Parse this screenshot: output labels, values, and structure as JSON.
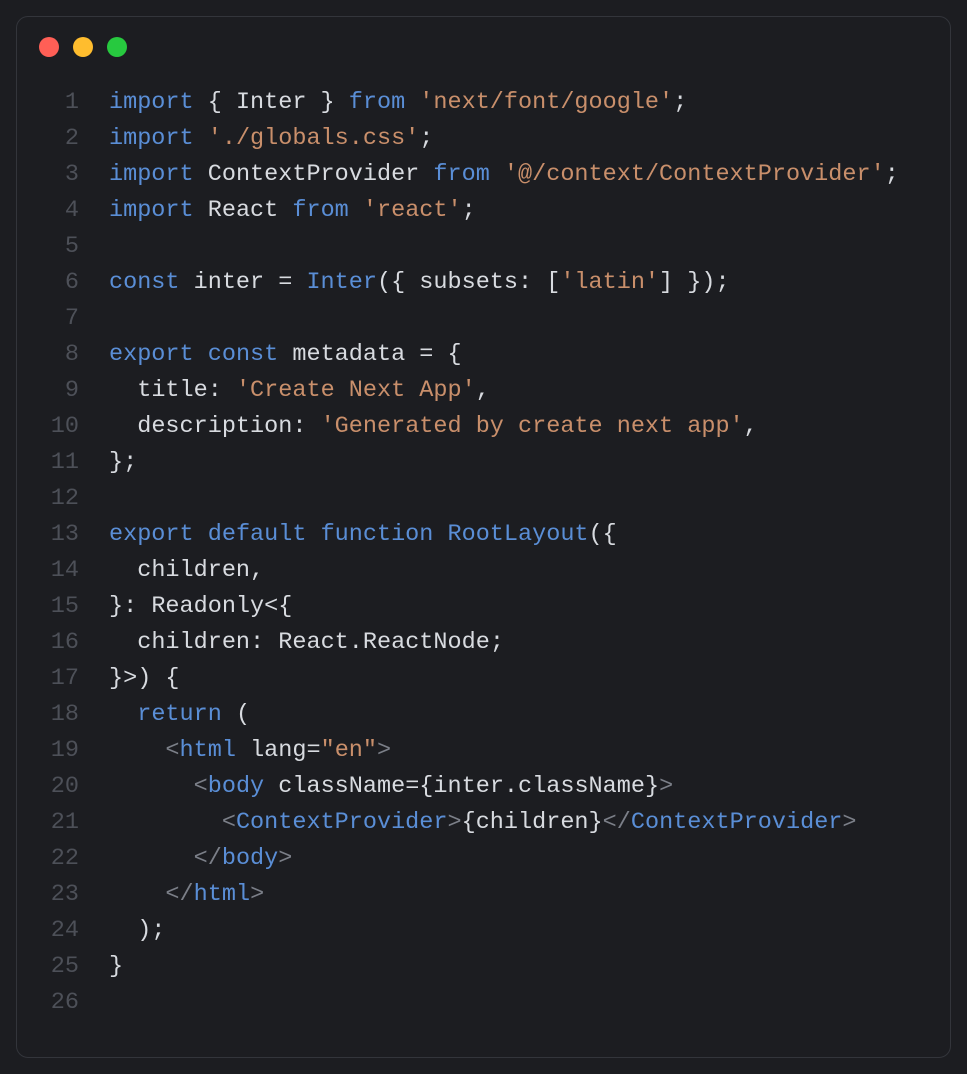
{
  "window": {
    "traffic": [
      "red",
      "yellow",
      "green"
    ]
  },
  "code": {
    "lines": [
      {
        "n": "1",
        "tokens": [
          [
            "kw",
            "import"
          ],
          [
            "pl",
            " { "
          ],
          [
            "id",
            "Inter"
          ],
          [
            "pl",
            " } "
          ],
          [
            "kw",
            "from"
          ],
          [
            "pl",
            " "
          ],
          [
            "str",
            "'next/font/google'"
          ],
          [
            "pl",
            ";"
          ]
        ]
      },
      {
        "n": "2",
        "tokens": [
          [
            "kw",
            "import"
          ],
          [
            "pl",
            " "
          ],
          [
            "str",
            "'./globals.css'"
          ],
          [
            "pl",
            ";"
          ]
        ]
      },
      {
        "n": "3",
        "tokens": [
          [
            "kw",
            "import"
          ],
          [
            "pl",
            " "
          ],
          [
            "id",
            "ContextProvider"
          ],
          [
            "pl",
            " "
          ],
          [
            "kw",
            "from"
          ],
          [
            "pl",
            " "
          ],
          [
            "str",
            "'@/context/ContextProvider'"
          ],
          [
            "pl",
            ";"
          ]
        ]
      },
      {
        "n": "4",
        "tokens": [
          [
            "kw",
            "import"
          ],
          [
            "pl",
            " "
          ],
          [
            "id",
            "React"
          ],
          [
            "pl",
            " "
          ],
          [
            "kw",
            "from"
          ],
          [
            "pl",
            " "
          ],
          [
            "str",
            "'react'"
          ],
          [
            "pl",
            ";"
          ]
        ]
      },
      {
        "n": "5",
        "tokens": [
          [
            "pl",
            ""
          ]
        ]
      },
      {
        "n": "6",
        "tokens": [
          [
            "kw",
            "const"
          ],
          [
            "pl",
            " "
          ],
          [
            "id",
            "inter"
          ],
          [
            "pl",
            " = "
          ],
          [
            "fn",
            "Inter"
          ],
          [
            "pl",
            "({ "
          ],
          [
            "id",
            "subsets"
          ],
          [
            "pl",
            ": ["
          ],
          [
            "str",
            "'latin'"
          ],
          [
            "pl",
            "] });"
          ]
        ]
      },
      {
        "n": "7",
        "tokens": [
          [
            "pl",
            ""
          ]
        ]
      },
      {
        "n": "8",
        "tokens": [
          [
            "kw",
            "export"
          ],
          [
            "pl",
            " "
          ],
          [
            "kw",
            "const"
          ],
          [
            "pl",
            " "
          ],
          [
            "id",
            "metadata"
          ],
          [
            "pl",
            " = {"
          ]
        ]
      },
      {
        "n": "9",
        "tokens": [
          [
            "pl",
            "  "
          ],
          [
            "id",
            "title"
          ],
          [
            "pl",
            ": "
          ],
          [
            "str",
            "'Create Next App'"
          ],
          [
            "pl",
            ","
          ]
        ]
      },
      {
        "n": "10",
        "tokens": [
          [
            "pl",
            "  "
          ],
          [
            "id",
            "description"
          ],
          [
            "pl",
            ": "
          ],
          [
            "str",
            "'Generated by create next app'"
          ],
          [
            "pl",
            ","
          ]
        ]
      },
      {
        "n": "11",
        "tokens": [
          [
            "pl",
            "};"
          ]
        ]
      },
      {
        "n": "12",
        "tokens": [
          [
            "pl",
            ""
          ]
        ]
      },
      {
        "n": "13",
        "tokens": [
          [
            "kw",
            "export"
          ],
          [
            "pl",
            " "
          ],
          [
            "kw",
            "default"
          ],
          [
            "pl",
            " "
          ],
          [
            "kw",
            "function"
          ],
          [
            "pl",
            " "
          ],
          [
            "fn",
            "RootLayout"
          ],
          [
            "pl",
            "({"
          ]
        ]
      },
      {
        "n": "14",
        "tokens": [
          [
            "pl",
            "  "
          ],
          [
            "id",
            "children"
          ],
          [
            "pl",
            ","
          ]
        ]
      },
      {
        "n": "15",
        "tokens": [
          [
            "pl",
            "}: "
          ],
          [
            "id",
            "Readonly"
          ],
          [
            "pl",
            "<{"
          ]
        ]
      },
      {
        "n": "16",
        "tokens": [
          [
            "pl",
            "  "
          ],
          [
            "id",
            "children"
          ],
          [
            "pl",
            ": "
          ],
          [
            "id",
            "React"
          ],
          [
            "pl",
            "."
          ],
          [
            "id",
            "ReactNode"
          ],
          [
            "pl",
            ";"
          ]
        ]
      },
      {
        "n": "17",
        "tokens": [
          [
            "pl",
            "}>"
          ],
          [
            "pl",
            ") {"
          ]
        ]
      },
      {
        "n": "18",
        "tokens": [
          [
            "pl",
            "  "
          ],
          [
            "kw",
            "return"
          ],
          [
            "pl",
            " ("
          ]
        ]
      },
      {
        "n": "19",
        "tokens": [
          [
            "pl",
            "    "
          ],
          [
            "ang",
            "<"
          ],
          [
            "tag",
            "html"
          ],
          [
            "pl",
            " "
          ],
          [
            "attr",
            "lang"
          ],
          [
            "pl",
            "="
          ],
          [
            "attrv",
            "\"en\""
          ],
          [
            "ang",
            ">"
          ]
        ]
      },
      {
        "n": "20",
        "tokens": [
          [
            "pl",
            "      "
          ],
          [
            "ang",
            "<"
          ],
          [
            "tag",
            "body"
          ],
          [
            "pl",
            " "
          ],
          [
            "attr",
            "className"
          ],
          [
            "pl",
            "="
          ],
          [
            "brace",
            "{"
          ],
          [
            "id",
            "inter"
          ],
          [
            "pl",
            "."
          ],
          [
            "id",
            "className"
          ],
          [
            "brace",
            "}"
          ],
          [
            "ang",
            ">"
          ]
        ]
      },
      {
        "n": "21",
        "tokens": [
          [
            "pl",
            "        "
          ],
          [
            "ang",
            "<"
          ],
          [
            "tag",
            "ContextProvider"
          ],
          [
            "ang",
            ">"
          ],
          [
            "brace",
            "{"
          ],
          [
            "id",
            "children"
          ],
          [
            "brace",
            "}"
          ],
          [
            "ang",
            "</"
          ],
          [
            "tag",
            "ContextProvider"
          ],
          [
            "ang",
            ">"
          ]
        ]
      },
      {
        "n": "22",
        "tokens": [
          [
            "pl",
            "      "
          ],
          [
            "ang",
            "</"
          ],
          [
            "tag",
            "body"
          ],
          [
            "ang",
            ">"
          ]
        ]
      },
      {
        "n": "23",
        "tokens": [
          [
            "pl",
            "    "
          ],
          [
            "ang",
            "</"
          ],
          [
            "tag",
            "html"
          ],
          [
            "ang",
            ">"
          ]
        ]
      },
      {
        "n": "24",
        "tokens": [
          [
            "pl",
            "  );"
          ]
        ]
      },
      {
        "n": "25",
        "tokens": [
          [
            "pl",
            "}"
          ]
        ]
      },
      {
        "n": "26",
        "tokens": [
          [
            "pl",
            ""
          ]
        ]
      }
    ]
  }
}
